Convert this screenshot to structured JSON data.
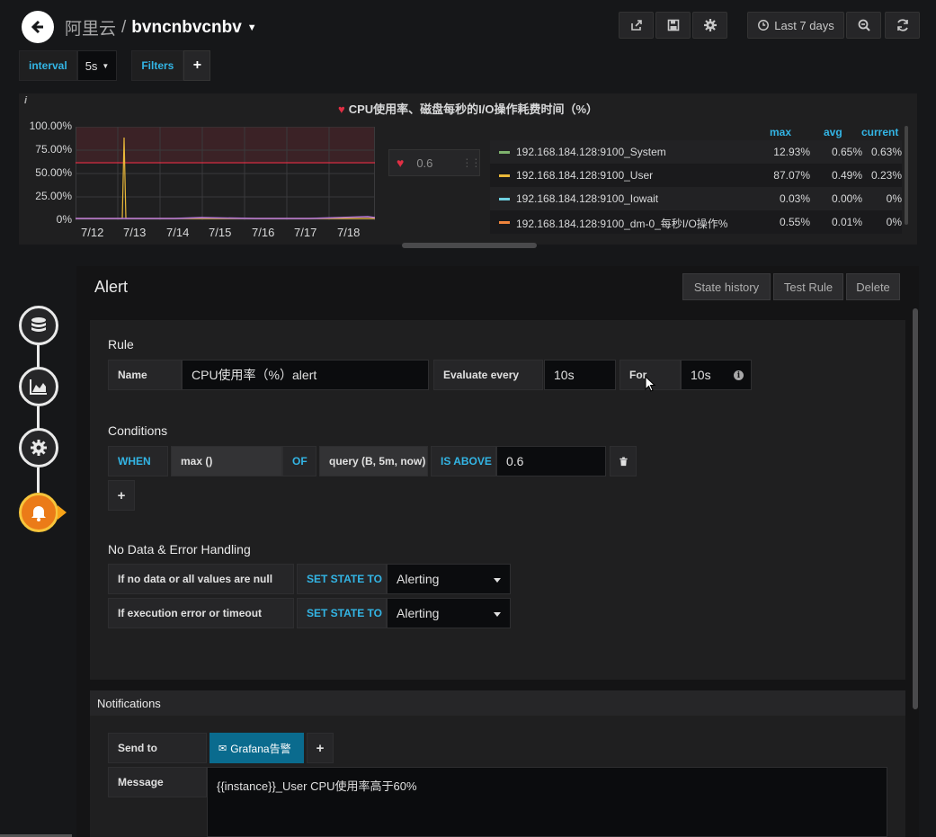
{
  "nav": {
    "breadcrumb_folder": "阿里云",
    "breadcrumb_sep": "/",
    "dashboard_title": "bvncnbvcnbv",
    "time_range": "Last 7 days"
  },
  "variables": {
    "interval_label": "interval",
    "interval_value": "5s",
    "filters_label": "Filters",
    "add_label": "+"
  },
  "panel": {
    "info": "i",
    "title": "CPU使用率、磁盘每秒的I/O操作耗费时间（%）",
    "y_ticks": [
      "100.00%",
      "75.00%",
      "50.00%",
      "25.00%",
      "0%"
    ],
    "x_ticks": [
      "7/12",
      "7/13",
      "7/14",
      "7/15",
      "7/16",
      "7/17",
      "7/18"
    ],
    "threshold_value": "0.6",
    "legend_headers": {
      "max": "max",
      "avg": "avg",
      "current": "current"
    },
    "legend": [
      {
        "name": "192.168.184.128:9100_System",
        "max": "12.93%",
        "avg": "0.65%",
        "current": "0.63%",
        "color": "#7eb26d"
      },
      {
        "name": "192.168.184.128:9100_User",
        "max": "87.07%",
        "avg": "0.49%",
        "current": "0.23%",
        "color": "#eab839"
      },
      {
        "name": "192.168.184.128:9100_Iowait",
        "max": "0.03%",
        "avg": "0.00%",
        "current": "0%",
        "color": "#6ed0e0"
      },
      {
        "name": "192.168.184.128:9100_dm-0_每秒I/O操作%",
        "max": "0.55%",
        "avg": "0.01%",
        "current": "0%",
        "color": "#ef843c"
      }
    ]
  },
  "chart_data": {
    "type": "line",
    "title": "CPU使用率、磁盘每秒的I/O操作耗费时间（%）",
    "x": [
      "7/12",
      "7/13",
      "7/14",
      "7/15",
      "7/16",
      "7/17",
      "7/18"
    ],
    "ylim": [
      0,
      100
    ],
    "threshold": 60,
    "series": [
      {
        "name": "192.168.184.128:9100_User",
        "spike_at": "7/13",
        "spike_value": 87.07
      },
      {
        "name": "192.168.184.128:9100_System",
        "max": 12.93
      }
    ]
  },
  "alert": {
    "title": "Alert",
    "state_history": "State history",
    "test_rule": "Test Rule",
    "delete": "Delete",
    "rule_title": "Rule",
    "name_label": "Name",
    "name_value": "CPU使用率（%）alert",
    "evaluate_label": "Evaluate every",
    "evaluate_value": "10s",
    "for_label": "For",
    "for_value": "10s",
    "conditions_title": "Conditions",
    "when": "WHEN",
    "reducer": "max ()",
    "of": "OF",
    "query": "query (B, 5m, now)",
    "evaluator": "IS ABOVE",
    "evaluator_value": "0.6",
    "add_condition": "+",
    "nodata_title": "No Data & Error Handling",
    "nodata_label": "If no data or all values are null",
    "set_state_to": "SET STATE TO",
    "nodata_state": "Alerting",
    "error_label": "If execution error or timeout",
    "error_state": "Alerting"
  },
  "notifications": {
    "title": "Notifications",
    "send_to_label": "Send to",
    "channel": "Grafana告警",
    "add": "+",
    "message_label": "Message",
    "message_value": "{{instance}}_User  CPU使用率高于60%"
  }
}
